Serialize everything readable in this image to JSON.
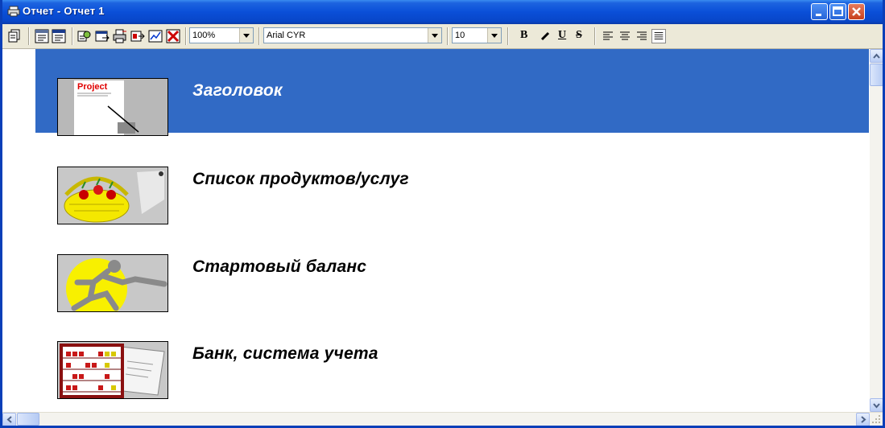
{
  "window": {
    "title": "Отчет - Отчет 1",
    "title_bar_color": "#0a4fd8",
    "selection_color": "#316ac5"
  },
  "toolbar": {
    "zoom": "100%",
    "font_name": "Arial CYR",
    "font_size": "10",
    "bold_label": "B",
    "underline_label": "U",
    "strike_label": "S",
    "icons": [
      "print-preview-icon",
      "report-icon",
      "report-alt-icon",
      "page-settings-icon",
      "export-icon",
      "print-icon",
      "print-export-icon",
      "chart-icon",
      "delete-icon",
      "bold-icon",
      "italic-icon",
      "underline-icon",
      "strikethrough-icon",
      "align-left-icon",
      "align-center-icon",
      "align-right-icon",
      "justify-icon"
    ]
  },
  "report_sections": [
    {
      "label": "Заголовок",
      "icon": "project-document-icon",
      "selected": true
    },
    {
      "label": "Список продуктов/услуг",
      "icon": "fruit-basket-icon",
      "selected": false
    },
    {
      "label": "Стартовый баланс",
      "icon": "running-man-icon",
      "selected": false
    },
    {
      "label": "Банк, система учета",
      "icon": "abacus-icon",
      "selected": false
    }
  ],
  "thumb_caption": "Project"
}
